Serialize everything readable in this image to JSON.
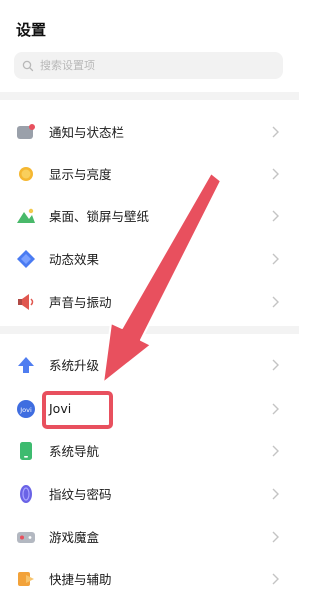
{
  "header": {
    "title": "设置"
  },
  "search": {
    "placeholder": "搜索设置项"
  },
  "items": [
    {
      "label": "通知与状态栏",
      "icon": "notification-icon",
      "color": "#8a8f99"
    },
    {
      "label": "显示与亮度",
      "icon": "brightness-icon",
      "color": "#f5b731"
    },
    {
      "label": "桌面、锁屏与壁纸",
      "icon": "wallpaper-icon",
      "color": "#49b96a"
    },
    {
      "label": "动态效果",
      "icon": "dynamic-effect-icon",
      "color": "#4a7bf2"
    },
    {
      "label": "声音与振动",
      "icon": "sound-icon",
      "color": "#e0574f"
    },
    {
      "label": "系统升级",
      "icon": "system-upgrade-icon",
      "color": "#4f7df0"
    },
    {
      "label": "Jovi",
      "icon": "jovi-icon",
      "color": "#3f6de0"
    },
    {
      "label": "系统导航",
      "icon": "system-navigation-icon",
      "color": "#3dbb6f"
    },
    {
      "label": "指纹与密码",
      "icon": "fingerprint-icon",
      "color": "#6a63e6"
    },
    {
      "label": "游戏魔盒",
      "icon": "game-box-icon",
      "color": "#9aa0aa"
    },
    {
      "label": "快捷与辅助",
      "icon": "shortcut-icon",
      "color": "#f2a23a"
    }
  ],
  "annotation": {
    "color": "#e8505e"
  }
}
